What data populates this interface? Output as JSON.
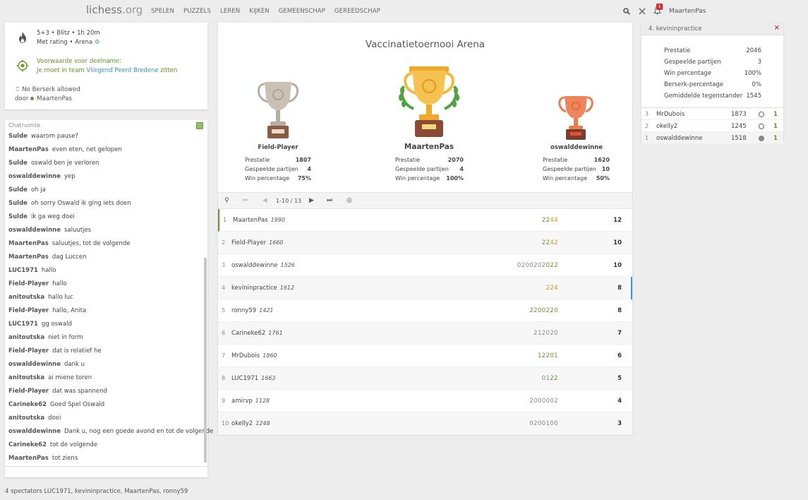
{
  "header": {
    "logo_main": "lichess",
    "logo_suffix": ".org",
    "nav": [
      "SPELEN",
      "PUZZELS",
      "LEREN",
      "KIJKEN",
      "GEMEENSCHAP",
      "GEREEDSCHAP"
    ],
    "notification_count": "1",
    "username": "MaartenPas"
  },
  "info": {
    "line1": "5+3 • Blitz • 1h 20m",
    "line2": "Met rating • Arena",
    "condition_label": "Voorwaarde voor deelname:",
    "condition_pre": "Je moet in team ",
    "condition_team": "Vliegend Peerd Bredene",
    "condition_post": " zitten",
    "berserk": "No Berserk allowed",
    "by_label": "door",
    "by_user": "MaartenPas"
  },
  "chat": {
    "title": "Chatruimte",
    "lines": [
      {
        "user": "Sulde",
        "text": "waarom pause?"
      },
      {
        "user": "MaartenPas",
        "text": "even eten, net gelopen"
      },
      {
        "user": "Sulde",
        "text": "oswald ben je verloren"
      },
      {
        "user": "oswalddewinne",
        "text": "yep"
      },
      {
        "user": "Sulde",
        "text": "oh ja"
      },
      {
        "user": "Sulde",
        "text": "oh sorry Oswald ik ging iets doen"
      },
      {
        "user": "Sulde",
        "text": "ik ga weg doei"
      },
      {
        "user": "oswalddewinne",
        "text": "saluutjes"
      },
      {
        "user": "MaartenPas",
        "text": "saluutjes, tot de volgende"
      },
      {
        "user": "MaartenPas",
        "text": "dag Luccen"
      },
      {
        "user": "LUC1971",
        "text": "hallo"
      },
      {
        "user": "Field-Player",
        "text": "hallo"
      },
      {
        "user": "anitoutska",
        "text": "hallo luc"
      },
      {
        "user": "Field-Player",
        "text": "hallo, Anita"
      },
      {
        "user": "LUC1971",
        "text": "gg oswald"
      },
      {
        "user": "anitoutska",
        "text": "niet in form"
      },
      {
        "user": "Field-Player",
        "text": "dat is relatief he"
      },
      {
        "user": "oswalddewinne",
        "text": "dank u"
      },
      {
        "user": "anitoutska",
        "text": "ai miene toren"
      },
      {
        "user": "Field-Player",
        "text": "dat was spannend"
      },
      {
        "user": "Carineke62",
        "text": "Goed Spel Oswald"
      },
      {
        "user": "anitoutska",
        "text": "doei"
      },
      {
        "user": "oswalddewinne",
        "text": "Dank u, nog een goede avond en tot de volgende"
      },
      {
        "user": "Carineke62",
        "text": "tot de volgende"
      },
      {
        "user": "MaartenPas",
        "text": "tot ziens"
      }
    ]
  },
  "spectators": "4 spectators LUC1971, kevininpractice, MaartenPas, ronny59",
  "tournament": {
    "title": "Vaccinatietoernooi Arena",
    "stat_labels": {
      "perf": "Prestatie",
      "games": "Gespeelde partijen",
      "win": "Win percentage"
    },
    "podium": [
      {
        "name": "Field-Player",
        "perf": "1807",
        "games": "4",
        "win": "75%",
        "trophy_color": "#b8ad9e"
      },
      {
        "name": "MaartenPas",
        "perf": "2070",
        "games": "4",
        "win": "100%",
        "trophy_color": "#f5b93a"
      },
      {
        "name": "oswalddewinne",
        "perf": "1620",
        "games": "10",
        "win": "50%",
        "trophy_color": "#ee7a4f"
      }
    ],
    "pager_text": "1-10 / 13",
    "standings": [
      {
        "rank": "1",
        "name": "MaartenPas",
        "rating": "1990",
        "sheet": [
          {
            "t": "2",
            "c": "g"
          },
          {
            "t": "2",
            "c": "g"
          },
          {
            "t": "4",
            "c": "o"
          },
          {
            "t": "4",
            "c": "o"
          }
        ],
        "points": "12"
      },
      {
        "rank": "2",
        "name": "Field-Player",
        "rating": "1660",
        "sheet": [
          {
            "t": "2",
            "c": "g"
          },
          {
            "t": "2",
            "c": "g"
          },
          {
            "t": "4",
            "c": "o"
          },
          {
            "t": "2",
            "c": "o"
          }
        ],
        "points": "10"
      },
      {
        "rank": "3",
        "name": "oswalddewinne",
        "rating": "1526",
        "sheet": [
          {
            "t": "0200202",
            "c": "n"
          },
          {
            "t": "0",
            "c": "g"
          },
          {
            "t": "2",
            "c": "g"
          },
          {
            "t": "2",
            "c": "g"
          }
        ],
        "points": "10"
      },
      {
        "rank": "4",
        "name": "kevininpractice",
        "rating": "1612",
        "sheet": [
          {
            "t": "224",
            "c": "o"
          }
        ],
        "points": "8"
      },
      {
        "rank": "5",
        "name": "ronny59",
        "rating": "1421",
        "sheet": [
          {
            "t": "2200220",
            "c": "g"
          }
        ],
        "points": "8"
      },
      {
        "rank": "6",
        "name": "Carineke62",
        "rating": "1761",
        "sheet": [
          {
            "t": "212020",
            "c": "n"
          }
        ],
        "points": "7"
      },
      {
        "rank": "7",
        "name": "MrDubois",
        "rating": "1860",
        "sheet": [
          {
            "t": "12201",
            "c": "g"
          }
        ],
        "points": "6"
      },
      {
        "rank": "8",
        "name": "LUC1971",
        "rating": "1663",
        "sheet": [
          {
            "t": "01",
            "c": "n"
          },
          {
            "t": "22",
            "c": "g"
          }
        ],
        "points": "5"
      },
      {
        "rank": "9",
        "name": "amirvp",
        "rating": "1128",
        "sheet": [
          {
            "t": "2000002",
            "c": "n"
          }
        ],
        "points": "4"
      },
      {
        "rank": "10",
        "name": "okelly2",
        "rating": "1248",
        "sheet": [
          {
            "t": "0200100",
            "c": "n"
          }
        ],
        "points": "3"
      }
    ]
  },
  "player_panel": {
    "title": "4. kevininpractice",
    "stats": [
      {
        "label": "Prestatie",
        "value": "2046"
      },
      {
        "label": "Gespeelde partijen",
        "value": "3"
      },
      {
        "label": "Win percentage",
        "value": "100%"
      },
      {
        "label": "Berserk-percentage",
        "value": "0%"
      },
      {
        "label": "Gemiddelde tegenstander",
        "value": "1545"
      }
    ],
    "games": [
      {
        "round": "3",
        "opponent": "MrDubois",
        "rating": "1873",
        "color": "white",
        "score": "1"
      },
      {
        "round": "2",
        "opponent": "okelly2",
        "rating": "1245",
        "color": "white",
        "score": "1"
      },
      {
        "round": "1",
        "opponent": "oswalddewinne",
        "rating": "1518",
        "color": "black",
        "score": "1"
      }
    ]
  }
}
